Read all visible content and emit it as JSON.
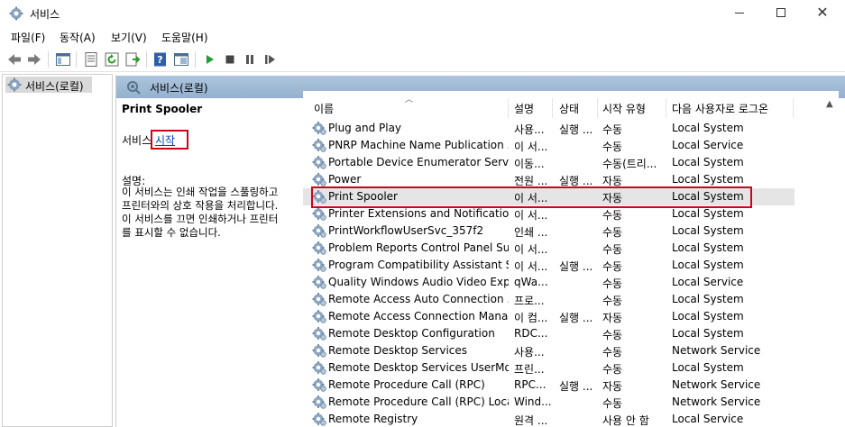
{
  "window": {
    "title": "서비스"
  },
  "menu": [
    "파일(F)",
    "동작(A)",
    "보기(V)",
    "도움말(H)"
  ],
  "toolbar": {
    "items": [
      "back-icon",
      "forward-icon",
      "show-hide-tree-icon",
      "properties-icon",
      "refresh-icon",
      "export-icon",
      "help-icon",
      "console-icon",
      "start-service-icon",
      "stop-service-icon",
      "pause-service-icon",
      "restart-service-icon"
    ]
  },
  "tree": {
    "selected_label": "서비스(로컬)"
  },
  "pane": {
    "title": "서비스(로컬)"
  },
  "detail": {
    "service_name": "Print Spooler",
    "start_prefix": "서비스",
    "start_link": "시작",
    "description_label": "설명:",
    "description": "이 서비스는 인쇄 작업을 스풀링하고\n프린터와의 상호 작용을 처리합니다.\n이 서비스를 끄면 인쇄하거나 프린터\n를 표시할 수 없습니다."
  },
  "columns": {
    "name": "이름",
    "desc": "설명",
    "status": "상태",
    "start_type": "시작 유형",
    "logon": "다음 사용자로 로그온"
  },
  "services": [
    {
      "name": "Plug and Play",
      "desc": "사용...",
      "status": "실행 ...",
      "start_type": "수동",
      "logon": "Local System"
    },
    {
      "name": "PNRP Machine Name Publication ...",
      "desc": "이 서...",
      "status": "",
      "start_type": "수동",
      "logon": "Local Service"
    },
    {
      "name": "Portable Device Enumerator Service",
      "desc": "이동...",
      "status": "",
      "start_type": "수동(트리...",
      "logon": "Local System"
    },
    {
      "name": "Power",
      "desc": "전원 ...",
      "status": "실행 ...",
      "start_type": "자동",
      "logon": "Local System"
    },
    {
      "name": "Print Spooler",
      "desc": "이 서...",
      "status": "",
      "start_type": "자동",
      "logon": "Local System",
      "selected": true
    },
    {
      "name": "Printer Extensions and Notifications",
      "desc": "이 서...",
      "status": "",
      "start_type": "수동",
      "logon": "Local System"
    },
    {
      "name": "PrintWorkflowUserSvc_357f2",
      "desc": "인쇄 ...",
      "status": "",
      "start_type": "수동",
      "logon": "Local System"
    },
    {
      "name": "Problem Reports Control Panel Su...",
      "desc": "이 서...",
      "status": "",
      "start_type": "수동",
      "logon": "Local System"
    },
    {
      "name": "Program Compatibility Assistant S...",
      "desc": "이 서...",
      "status": "실행 ...",
      "start_type": "수동",
      "logon": "Local System"
    },
    {
      "name": "Quality Windows Audio Video Exp...",
      "desc": "qWa...",
      "status": "",
      "start_type": "수동",
      "logon": "Local Service"
    },
    {
      "name": "Remote Access Auto Connection ...",
      "desc": "프로...",
      "status": "",
      "start_type": "수동",
      "logon": "Local System"
    },
    {
      "name": "Remote Access Connection Manager",
      "desc": "이 컴...",
      "status": "실행 ...",
      "start_type": "자동",
      "logon": "Local System"
    },
    {
      "name": "Remote Desktop Configuration",
      "desc": "RDC...",
      "status": "",
      "start_type": "수동",
      "logon": "Local System"
    },
    {
      "name": "Remote Desktop Services",
      "desc": "사용...",
      "status": "",
      "start_type": "수동",
      "logon": "Network Service"
    },
    {
      "name": "Remote Desktop Services UserMod...",
      "desc": "프린...",
      "status": "",
      "start_type": "수동",
      "logon": "Local System"
    },
    {
      "name": "Remote Procedure Call (RPC)",
      "desc": "RPC...",
      "status": "실행 ...",
      "start_type": "자동",
      "logon": "Network Service"
    },
    {
      "name": "Remote Procedure Call (RPC) Loca...",
      "desc": "Wind...",
      "status": "",
      "start_type": "수동",
      "logon": "Network Service"
    },
    {
      "name": "Remote Registry",
      "desc": "원격 ...",
      "status": "",
      "start_type": "사용 안 함",
      "logon": "Local Service"
    }
  ],
  "colors": {
    "header_band": "#a7bfd9",
    "highlight_border": "#d0021b",
    "link": "#0645ad",
    "selected_row": "#e5e5e5"
  }
}
